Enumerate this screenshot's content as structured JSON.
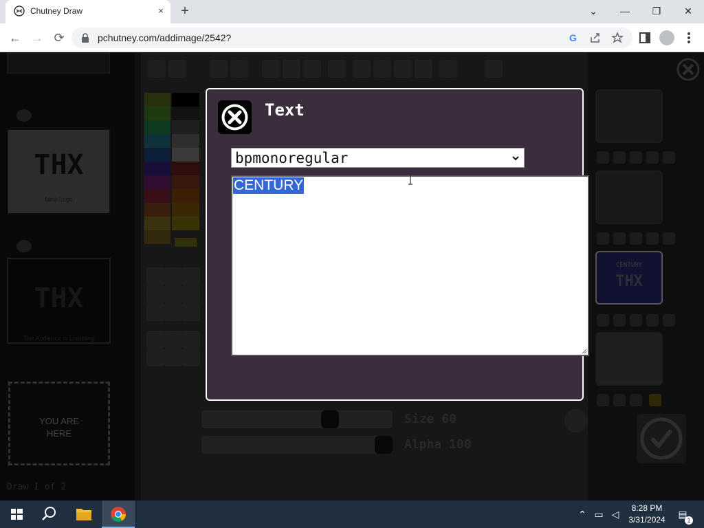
{
  "browser": {
    "tab_title": "Chutney Draw",
    "tab_close_icon": "×",
    "new_tab_icon": "+",
    "url": "pchutney.com/addimage/2542?",
    "window_controls": {
      "chevron": "⌄",
      "minimize": "—",
      "restore": "❐",
      "close": "✕"
    },
    "nav": {
      "back": "←",
      "forward": "→",
      "reload": "⟳"
    }
  },
  "sidebar": {
    "images": [
      {
        "logo_text": "THX",
        "caption": "New Logo"
      },
      {
        "logo_text": "THX",
        "caption": "The Audience Is Listening"
      }
    ],
    "placeholder": {
      "line1": "YOU ARE",
      "line2": "HERE"
    },
    "status": "Draw 1 of 2"
  },
  "canvas": {
    "size_label": "Size 60",
    "alpha_label": "Alpha 100",
    "size_value": 60,
    "alpha_value": 100
  },
  "layers": {
    "thumb_text_top": "CENTURY",
    "thumb_text_bottom": "THX"
  },
  "modal": {
    "title": "Text",
    "font_selected": "bpmonoregular",
    "text_value": "CENTURY"
  },
  "taskbar": {
    "time": "8:28 PM",
    "date": "3/31/2024",
    "notifications": "1"
  }
}
